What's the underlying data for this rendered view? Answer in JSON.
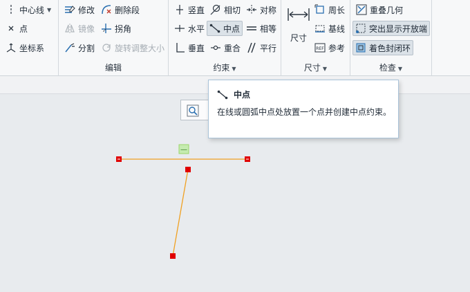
{
  "ribbon": {
    "sketch_group": {
      "centerline": "中心线",
      "point": "点",
      "coordsys": "坐标系"
    },
    "edit_group": {
      "label": "编辑",
      "modify": "修改",
      "delete_segment": "删除段",
      "mirror": "镜像",
      "corner": "拐角",
      "divide": "分割",
      "rotate_resize": "旋转调整大小"
    },
    "constrain_group": {
      "label": "约束",
      "vertical": "竖直",
      "tangent": "相切",
      "symmetric": "对称",
      "horizontal": "水平",
      "midpoint": "中点",
      "equal": "相等",
      "perpendicular": "垂直",
      "coincident": "重合",
      "parallel": "平行"
    },
    "dimension_group": {
      "label": "尺寸",
      "dimension": "尺寸",
      "perimeter": "周长",
      "baseline": "基线",
      "reference": "参考",
      "ref_icon_text": "REF"
    },
    "inspect_group": {
      "label": "检查",
      "overlap": "重叠几何",
      "highlight_open": "突出显示开放端",
      "shade_closed": "着色封闭环"
    }
  },
  "tooltip": {
    "title": "中点",
    "body": "在线或圆弧中点处放置一个点并创建中点约束。"
  },
  "colors": {
    "accent": "#2a6fb0",
    "sketch_line": "#f0a020",
    "vertex": "#e00000",
    "constraint_marker": "#9bd66a"
  },
  "sketch": {
    "constraint_glyph": "—"
  }
}
